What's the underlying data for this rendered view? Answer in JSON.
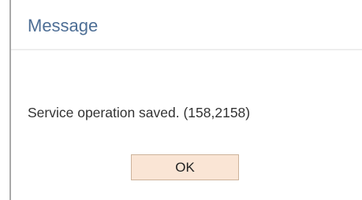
{
  "dialog": {
    "title": "Message",
    "message": "Service operation saved. (158,2158)",
    "ok_label": "OK"
  },
  "colors": {
    "title_text": "#4d6e95",
    "button_background": "#fae5d5",
    "button_border": "#cdb39b",
    "divider": "#eeeeee"
  }
}
